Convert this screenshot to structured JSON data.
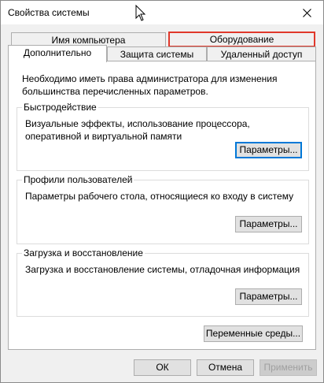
{
  "window": {
    "title": "Свойства системы"
  },
  "tabs": {
    "row1": [
      {
        "label": "Имя компьютера"
      },
      {
        "label": "Оборудование"
      }
    ],
    "row2": [
      {
        "label": "Дополнительно"
      },
      {
        "label": "Защита системы"
      },
      {
        "label": "Удаленный доступ"
      }
    ]
  },
  "panel": {
    "intro": "Необходимо иметь права администратора для изменения большинства перечисленных параметров.",
    "performance": {
      "title": "Быстродействие",
      "description": "Визуальные эффекты, использование процессора, оперативной и виртуальной памяти",
      "button": "Параметры..."
    },
    "profiles": {
      "title": "Профили пользователей",
      "description": "Параметры рабочего стола, относящиеся ко входу в систему",
      "button": "Параметры..."
    },
    "startup": {
      "title": "Загрузка и восстановление",
      "description": "Загрузка и восстановление системы, отладочная информация",
      "button": "Параметры..."
    },
    "env_button": "Переменные среды..."
  },
  "footer": {
    "ok": "ОК",
    "cancel": "Отмена",
    "apply": "Применить"
  },
  "colors": {
    "highlight": "#e0382b",
    "focus": "#0078d7"
  }
}
